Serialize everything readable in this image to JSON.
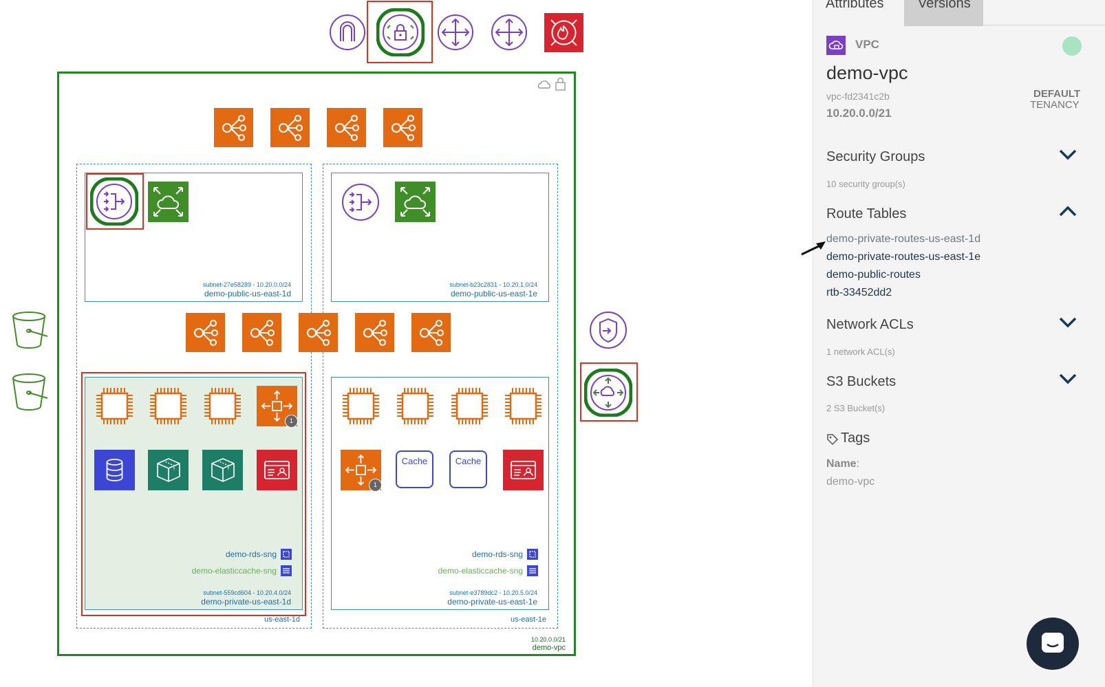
{
  "diagram": {
    "vpc_cidr": "10.20.0.0/21",
    "vpc_name": "demo-vpc",
    "az_left": "us-east-1d",
    "az_right": "us-east-1e",
    "subnets": [
      {
        "id_cidr": "subnet-27e58289 - 10.20.0.0/24",
        "name": "demo-public-us-east-1d"
      },
      {
        "id_cidr": "subnet-b23c2831 - 10.20.1.0/24",
        "name": "demo-public-us-east-1e"
      },
      {
        "id_cidr": "subnet-559cd604 - 10.20.4.0/24",
        "name": "demo-private-us-east-1d"
      },
      {
        "id_cidr": "subnet-e3789dc2 - 10.20.5.0/24",
        "name": "demo-private-us-east-1e"
      }
    ],
    "rds_sng": "demo-rds-sng",
    "elasticache_sng": "demo-elasticcache-sng",
    "cache_label": "Cache",
    "badge_count": "1",
    "colors": {
      "vpc_border": "#1d8a1d",
      "subnet_border": "#3b8fc4",
      "orange": "#e46a12",
      "green": "#3f8e28",
      "purple": "#7b3fc4",
      "red": "#d7242f",
      "blue": "#3b47d4",
      "teal": "#1e7d66",
      "highlight": "#e0301e"
    }
  },
  "panel": {
    "tab_attributes": "Attributes",
    "tab_versions": "Versions",
    "resource_type": "VPC",
    "title": "demo-vpc",
    "vpc_id": "vpc-fd2341c2b",
    "cidr": "10.20.0.0/21",
    "tenancy_line1": "DEFAULT",
    "tenancy_line2": "TENANCY",
    "security_groups": {
      "title": "Security Groups",
      "summary": "10 security group(s)"
    },
    "route_tables": {
      "title": "Route Tables",
      "items": [
        "demo-private-routes-us-east-1d",
        "demo-private-routes-us-east-1e",
        "demo-public-routes",
        "rtb-33452dd2"
      ]
    },
    "network_acls": {
      "title": "Network ACLs",
      "summary": "1 network ACL(s)"
    },
    "s3_buckets": {
      "title": "S3 Buckets",
      "summary": "2 S3 Bucket(s)"
    },
    "tags": {
      "title": "Tags",
      "key": "Name",
      "colon": ":",
      "value": "demo-vpc"
    }
  }
}
